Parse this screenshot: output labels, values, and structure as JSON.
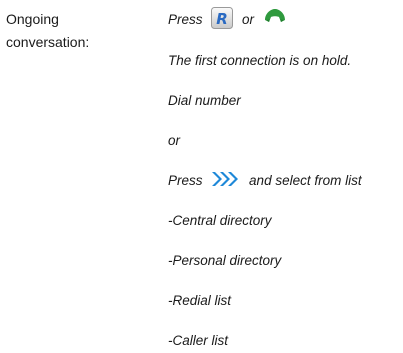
{
  "label": {
    "line1": "Ongoing",
    "line2": "conversation:"
  },
  "steps": {
    "press_prefix": "Press",
    "or_text": "or",
    "r_key": "R",
    "hold_note": "The first connection is on hold.",
    "dial": "Dial number",
    "or_line": "or",
    "press_prefix_2": "Press",
    "select_suffix": "and select from list",
    "central": "-Central directory",
    "personal": "-Personal directory",
    "redial": "-Redial list",
    "caller": "-Caller list"
  },
  "colors": {
    "key_blue": "#2a6ac2",
    "phone_green": "#2f9a3e",
    "arrow_blue": "#1e88d8"
  },
  "icons": [
    "r-key-icon",
    "phone-handset-icon",
    "forward-arrows-icon"
  ]
}
